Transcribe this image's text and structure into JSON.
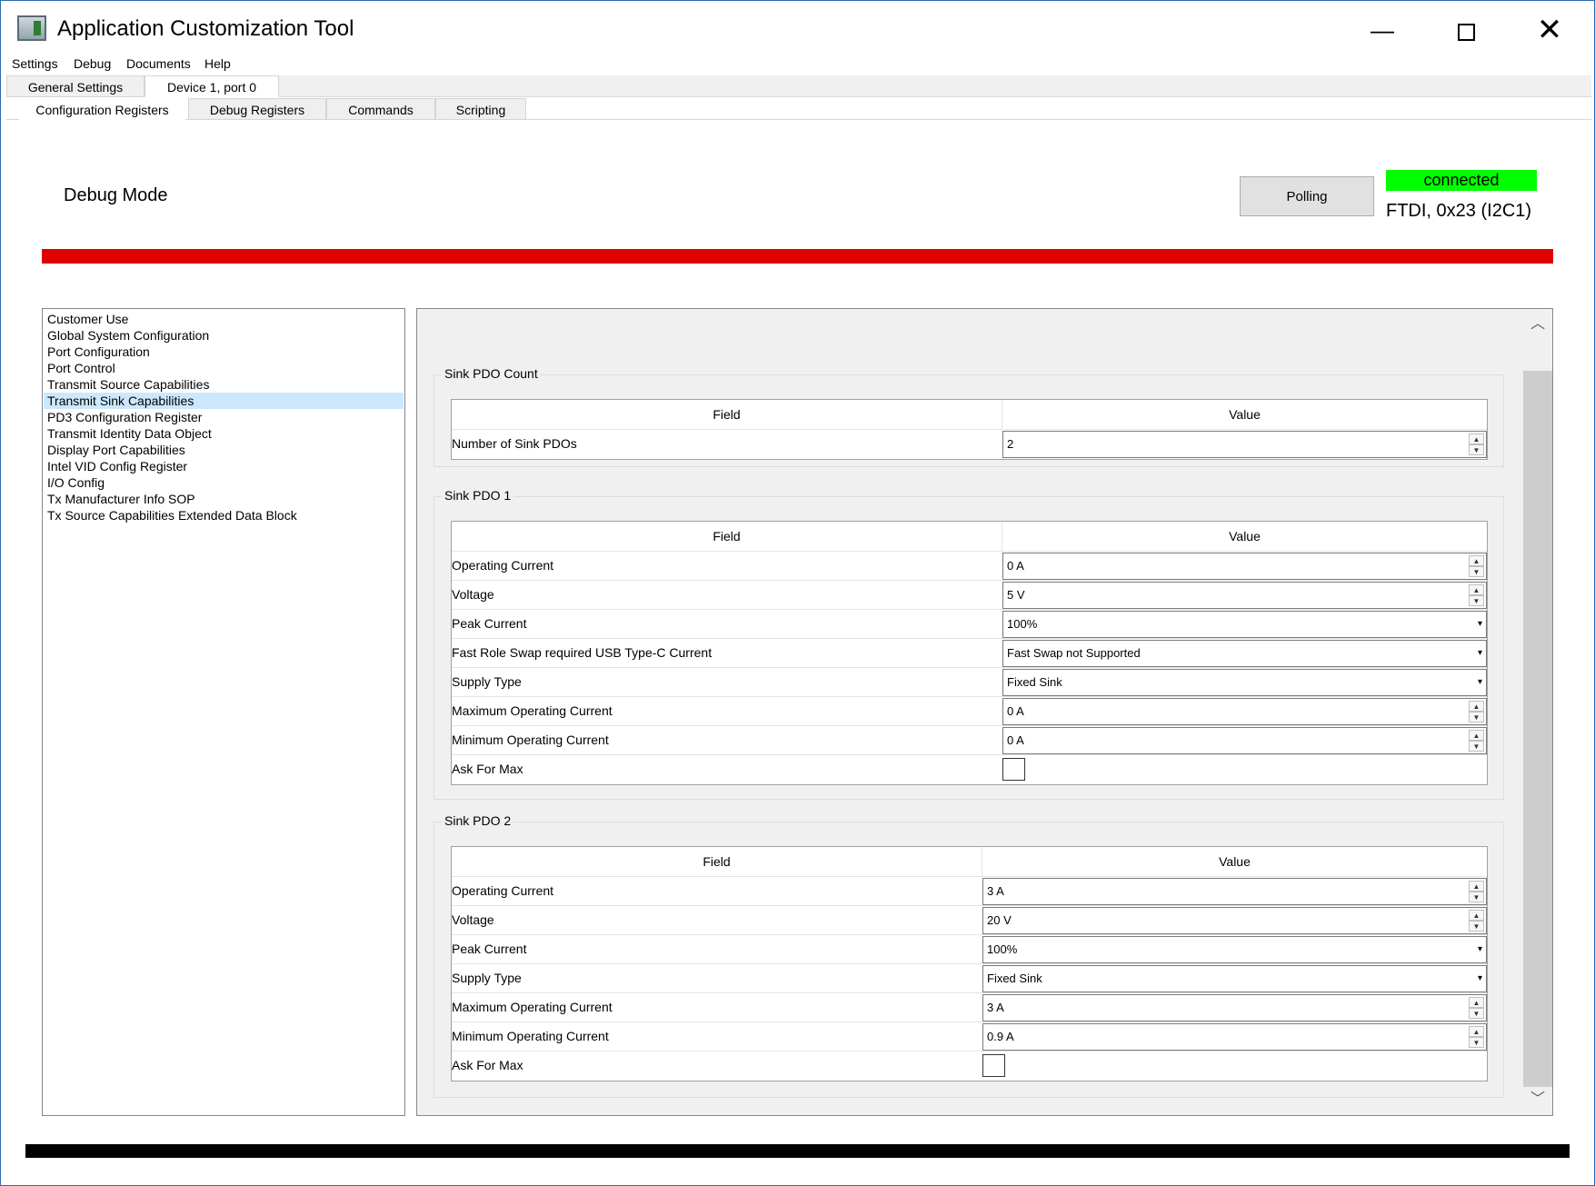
{
  "window": {
    "title": "Application Customization Tool",
    "minimize": "—",
    "close": "✕"
  },
  "menu": [
    "Settings",
    "Debug",
    "Documents",
    "Help"
  ],
  "tabs_primary": [
    {
      "label": "General Settings",
      "active": false
    },
    {
      "label": "Device 1, port 0",
      "active": true
    }
  ],
  "tabs_secondary": [
    {
      "label": "Configuration Registers",
      "active": true
    },
    {
      "label": "Debug Registers",
      "active": false
    },
    {
      "label": "Commands",
      "active": false
    },
    {
      "label": "Scripting",
      "active": false
    }
  ],
  "header": {
    "mode_label": "Debug Mode",
    "polling_button": "Polling",
    "connection_status": "connected",
    "connection_device": "FTDI, 0x23 (I2C1)",
    "status_color": "#00ff00",
    "warning_bar_color": "#e00000"
  },
  "register_list": [
    "Customer Use",
    "Global System Configuration",
    "Port Configuration",
    "Port Control",
    "Transmit Source Capabilities",
    "Transmit Sink Capabilities",
    "PD3 Configuration Register",
    "Transmit Identity Data Object",
    "Display Port Capabilities",
    "Intel VID Config Register",
    "I/O Config",
    "Tx Manufacturer Info SOP",
    "Tx Source Capabilities Extended Data Block"
  ],
  "selected_register": "Transmit Sink Capabilities",
  "grid_headers": {
    "field": "Field",
    "value": "Value"
  },
  "groups": [
    {
      "title": "Sink PDO Count",
      "rows": [
        {
          "field": "Number of Sink PDOs",
          "value": "2",
          "control": "spin"
        }
      ]
    },
    {
      "title": "Sink PDO 1",
      "rows": [
        {
          "field": "Operating Current",
          "value": "0 A",
          "control": "spin"
        },
        {
          "field": "Voltage",
          "value": "5 V",
          "control": "spin"
        },
        {
          "field": "Peak Current",
          "value": "100%",
          "control": "dropdown"
        },
        {
          "field": "Fast Role Swap required USB Type-C Current",
          "value": "Fast Swap not Supported",
          "control": "dropdown"
        },
        {
          "field": "Supply Type",
          "value": "Fixed Sink",
          "control": "dropdown"
        },
        {
          "field": "Maximum Operating Current",
          "value": "0 A",
          "control": "spin"
        },
        {
          "field": "Minimum Operating Current",
          "value": "0 A",
          "control": "spin"
        },
        {
          "field": "Ask For Max",
          "value": "",
          "control": "checkbox",
          "checked": false
        }
      ]
    },
    {
      "title": "Sink PDO 2",
      "rows": [
        {
          "field": "Operating Current",
          "value": "3 A",
          "control": "spin"
        },
        {
          "field": "Voltage",
          "value": "20 V",
          "control": "spin"
        },
        {
          "field": "Peak Current",
          "value": "100%",
          "control": "dropdown"
        },
        {
          "field": "Supply Type",
          "value": "Fixed Sink",
          "control": "dropdown"
        },
        {
          "field": "Maximum Operating Current",
          "value": "3 A",
          "control": "spin"
        },
        {
          "field": "Minimum Operating Current",
          "value": "0.9 A",
          "control": "spin"
        },
        {
          "field": "Ask For Max",
          "value": "",
          "control": "checkbox",
          "checked": false
        }
      ]
    }
  ]
}
